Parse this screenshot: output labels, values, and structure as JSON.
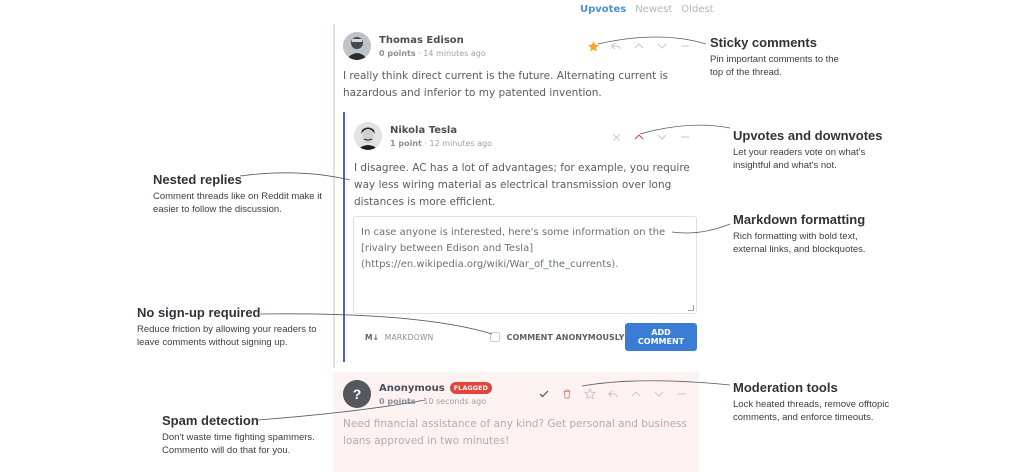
{
  "sort": {
    "options": [
      "Upvotes",
      "Newest",
      "Oldest"
    ],
    "active": "Upvotes"
  },
  "comments": {
    "edison": {
      "author": "Thomas Edison",
      "points": "0 points",
      "time": "· 14 minutes ago",
      "body": "I really think direct current is the future. Alternating current is hazardous and inferior to my patented invention."
    },
    "tesla": {
      "author": "Nikola Tesla",
      "points": "1 point",
      "time": "· 12 minutes ago",
      "body": "I disagree. AC has a lot of advantages; for example, you require way less wiring material as electrical transmission over long distances is more efficient."
    },
    "anonymous": {
      "author": "Anonymous",
      "flag": "FLAGGED",
      "points": "0 points",
      "time": "· 10 seconds ago",
      "body": "Need financial assistance of any kind? Get personal and business loans approved in two minutes!"
    }
  },
  "reply": {
    "text": "In case anyone is interested, here's some information on the [rivalry between Edison and Tesla](https://en.wikipedia.org/wiki/War_of_the_currents).",
    "markdown_label": "MARKDOWN",
    "markdown_icon": "M↓",
    "anonymous_label": "COMMENT ANONYMOUSLY",
    "submit_label": "ADD COMMENT"
  },
  "features": {
    "sticky": {
      "title": "Sticky comments",
      "desc": "Pin important comments to the top of the thread."
    },
    "votes": {
      "title": "Upvotes and downvotes",
      "desc": "Let your readers vote on what's insightful and what's not."
    },
    "nested": {
      "title": "Nested replies",
      "desc": "Comment threads like on Reddit make it easier to follow the discussion."
    },
    "markdown": {
      "title": "Markdown formatting",
      "desc": "Rich formatting with bold text, external links, and blockquotes."
    },
    "signup": {
      "title": "No sign-up required",
      "desc": "Reduce friction by allowing your readers to leave comments without signing up."
    },
    "moderation": {
      "title": "Moderation tools",
      "desc": "Lock heated threads, remove offtopic comments, and enforce timeouts."
    },
    "spam": {
      "title": "Spam detection",
      "desc": "Don't waste time fighting spammers. Commento will do that for you."
    }
  },
  "colors": {
    "accent": "#3d7cd4",
    "nested_border": "#4a63c4",
    "flag": "#e0453d",
    "star": "#f5a623",
    "upvoted": "#e0453d"
  }
}
